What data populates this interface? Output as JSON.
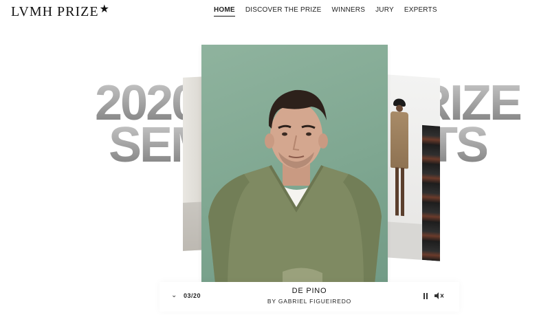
{
  "header": {
    "logo_text": "LVMH PRIZE",
    "logo_star": "★",
    "nav": [
      {
        "label": "HOME",
        "active": true
      },
      {
        "label": "DISCOVER THE PRIZE",
        "active": false
      },
      {
        "label": "WINNERS",
        "active": false
      },
      {
        "label": "JURY",
        "active": false
      },
      {
        "label": "EXPERTS",
        "active": false
      }
    ]
  },
  "background": {
    "line1_left": "2020",
    "line1_right": "PRIZE",
    "line2_left": "SEMI",
    "line2_right": "ISTS"
  },
  "slider": {
    "counter": "03/20",
    "designer_name": "DE PINO",
    "designer_by": "BY GABRIEL FIGUEIREDO",
    "chevron_icon": "chevron-down-icon",
    "pause_icon": "pause-icon",
    "mute_icon": "mute-icon"
  },
  "colors": {
    "portrait_background": "#7fa791",
    "sweater": "#7f8a62",
    "headline_gray": "#9a9a9a"
  }
}
